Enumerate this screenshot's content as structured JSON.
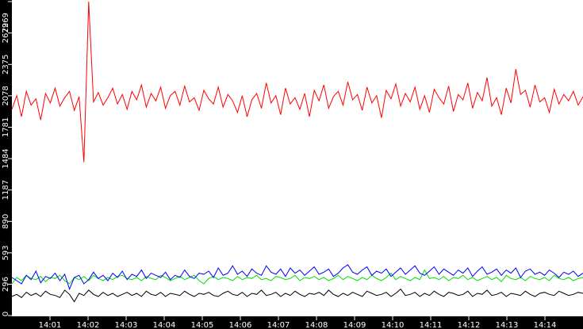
{
  "chart_data": {
    "type": "line",
    "title": "",
    "xlabel": "",
    "ylabel": "",
    "x_start_minutes": 0,
    "x_end_minutes": 15,
    "ylim": [
      0,
      2969
    ],
    "yticks": [
      "0",
      "296",
      "593",
      "890",
      "1187",
      "1484",
      "1781",
      "2078",
      "2375",
      "2672",
      "2969"
    ],
    "xticks": [
      "14:01",
      "14:02",
      "14:03",
      "14:04",
      "14:05",
      "14:06",
      "14:07",
      "14:08",
      "14:09",
      "14:10",
      "14:11",
      "14:12",
      "14:13",
      "14:14"
    ],
    "grid": false,
    "series": [
      {
        "name": "red",
        "color": "#ff0000",
        "values": [
          1950,
          2080,
          1880,
          2120,
          1990,
          2050,
          1850,
          2100,
          2010,
          2150,
          1980,
          2060,
          2120,
          1940,
          2070,
          1450,
          2969,
          2020,
          2110,
          1990,
          2060,
          2150,
          2000,
          2090,
          1950,
          2120,
          2040,
          2180,
          1970,
          2100,
          2030,
          2160,
          1960,
          2080,
          2120,
          1990,
          2170,
          2020,
          2060,
          1940,
          2130,
          2050,
          2000,
          2160,
          1970,
          2090,
          2030,
          1920,
          2080,
          1880,
          2040,
          2100,
          1960,
          2200,
          2010,
          2080,
          1900,
          2150,
          2000,
          2060,
          1950,
          2100,
          1880,
          2130,
          2030,
          2180,
          1960,
          2070,
          2120,
          1990,
          2210,
          2040,
          2090,
          1940,
          2160,
          2010,
          2080,
          1870,
          2130,
          2050,
          2190,
          1980,
          2100,
          2020,
          2160,
          1950,
          2080,
          1920,
          2140,
          2060,
          2000,
          2170,
          1930,
          2090,
          2040,
          2200,
          1960,
          2110,
          2030,
          2250,
          1980,
          2060,
          1900,
          2150,
          2010,
          2330,
          2090,
          2130,
          1970,
          2180,
          2020,
          2060,
          1920,
          2140,
          2000,
          2090,
          2030,
          2120,
          1990,
          2070
        ]
      },
      {
        "name": "blue",
        "color": "#0000ff",
        "values": [
          360,
          330,
          300,
          380,
          340,
          420,
          310,
          370,
          350,
          400,
          330,
          390,
          250,
          360,
          380,
          300,
          340,
          410,
          350,
          380,
          330,
          400,
          360,
          420,
          340,
          390,
          370,
          430,
          350,
          400,
          380,
          360,
          410,
          340,
          380,
          360,
          430,
          370,
          350,
          400,
          390,
          420,
          360,
          450,
          380,
          400,
          470,
          390,
          420,
          370,
          440,
          400,
          380,
          470,
          410,
          390,
          440,
          370,
          450,
          400,
          430,
          380,
          420,
          460,
          390,
          410,
          440,
          370,
          400,
          450,
          480,
          410,
          390,
          430,
          460,
          380,
          420,
          400,
          440,
          370,
          410,
          450,
          390,
          430,
          470,
          400,
          380,
          420,
          460,
          390,
          440,
          410,
          380,
          430,
          400,
          450,
          370,
          420,
          460,
          390,
          410,
          440,
          380,
          430,
          400,
          450,
          360,
          420,
          440,
          390,
          410,
          380,
          430,
          400,
          360,
          410,
          390,
          420,
          370,
          400
        ]
      },
      {
        "name": "green",
        "color": "#00e000",
        "values": [
          300,
          360,
          330,
          380,
          350,
          340,
          370,
          320,
          360,
          350,
          380,
          330,
          300,
          360,
          340,
          370,
          330,
          380,
          350,
          330,
          360,
          340,
          370,
          380,
          350,
          340,
          360,
          330,
          370,
          350,
          340,
          380,
          360,
          330,
          350,
          370,
          340,
          360,
          380,
          330,
          300,
          350,
          370,
          340,
          360,
          350,
          330,
          370,
          340,
          360,
          350,
          380,
          340,
          350,
          330,
          370,
          360,
          340,
          350,
          380,
          330,
          360,
          350,
          370,
          340,
          360,
          330,
          350,
          380,
          340,
          370,
          350,
          330,
          360,
          340,
          380,
          350,
          330,
          360,
          400,
          340,
          370,
          350,
          330,
          360,
          340,
          430,
          350,
          360,
          340,
          370,
          330,
          360,
          350,
          380,
          340,
          360,
          330,
          350,
          370,
          340,
          360,
          320,
          380,
          350,
          340,
          360,
          330,
          370,
          350,
          340,
          360,
          330,
          380,
          350,
          340,
          360,
          330,
          350,
          360
        ]
      },
      {
        "name": "black",
        "color": "#000000",
        "values": [
          180,
          200,
          170,
          220,
          190,
          210,
          180,
          230,
          200,
          190,
          170,
          240,
          200,
          130,
          210,
          190,
          240,
          200,
          180,
          220,
          190,
          210,
          180,
          200,
          220,
          190,
          210,
          180,
          230,
          200,
          190,
          220,
          180,
          210,
          200,
          190,
          230,
          200,
          180,
          210,
          200,
          220,
          190,
          180,
          210,
          230,
          200,
          190,
          220,
          180,
          210,
          200,
          240,
          190,
          200,
          220,
          180,
          210,
          190,
          230,
          200,
          180,
          210,
          200,
          220,
          190,
          240,
          200,
          180,
          210,
          190,
          220,
          200,
          180,
          230,
          210,
          190,
          200,
          220,
          180,
          210,
          250,
          190,
          200,
          220,
          180,
          210,
          190,
          230,
          200,
          180,
          220,
          210,
          190,
          200,
          230,
          180,
          210,
          200,
          240,
          190,
          200,
          220,
          180,
          210,
          200,
          190,
          230,
          200,
          180,
          210,
          220,
          200,
          190,
          230,
          210,
          190,
          200,
          220,
          210
        ]
      }
    ]
  }
}
